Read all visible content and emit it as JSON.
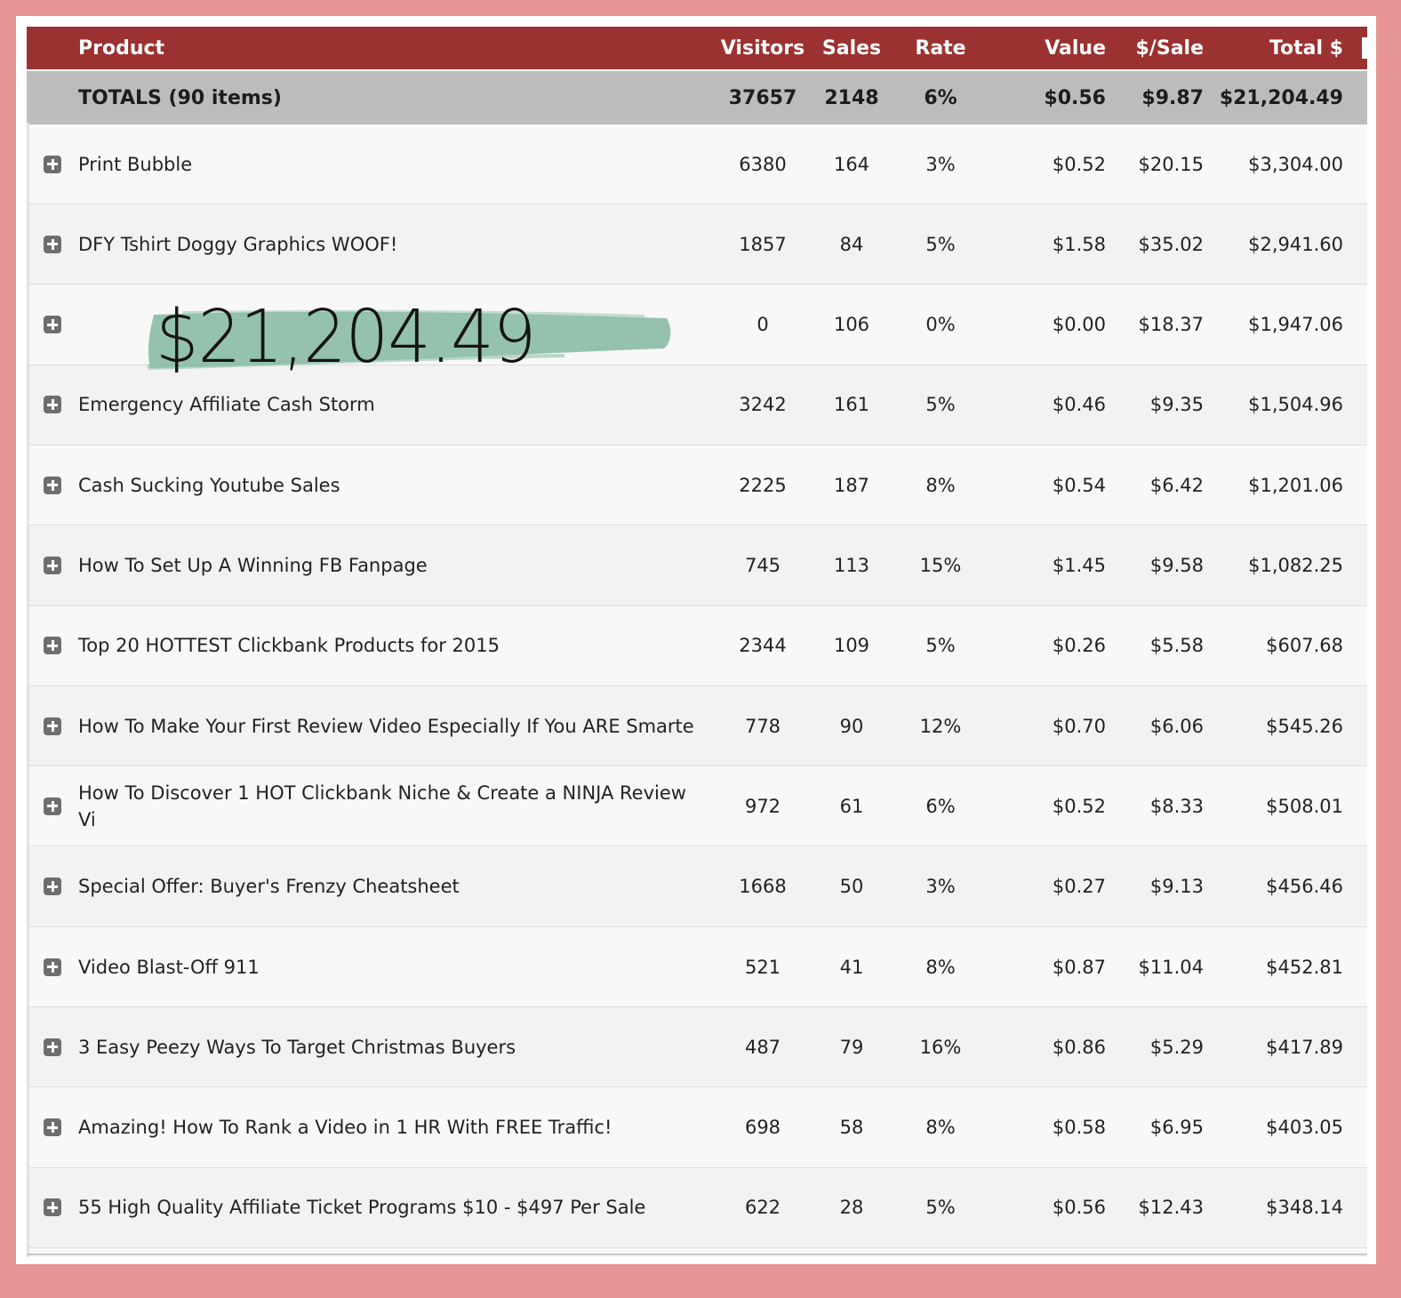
{
  "table": {
    "headers": {
      "product": "Product",
      "visitors": "Visitors",
      "sales": "Sales",
      "rate": "Rate",
      "value": "Value",
      "dollar_per_sale": "$/Sale",
      "total": "Total $"
    },
    "totals": {
      "label": "TOTALS (90 items)",
      "visitors": "37657",
      "sales": "2148",
      "rate": "6%",
      "value": "$0.56",
      "dollar_per_sale": "$9.87",
      "total": "$21,204.49"
    },
    "rows": [
      {
        "product": "Print Bubble",
        "visitors": "6380",
        "sales": "164",
        "rate": "3%",
        "value": "$0.52",
        "dollar_per_sale": "$20.15",
        "total": "$3,304.00"
      },
      {
        "product": "DFY Tshirt Doggy Graphics WOOF!",
        "visitors": "1857",
        "sales": "84",
        "rate": "5%",
        "value": "$1.58",
        "dollar_per_sale": "$35.02",
        "total": "$2,941.60"
      },
      {
        "product": "",
        "visitors": "0",
        "sales": "106",
        "rate": "0%",
        "value": "$0.00",
        "dollar_per_sale": "$18.37",
        "total": "$1,947.06"
      },
      {
        "product": "Emergency Affiliate Cash Storm",
        "visitors": "3242",
        "sales": "161",
        "rate": "5%",
        "value": "$0.46",
        "dollar_per_sale": "$9.35",
        "total": "$1,504.96"
      },
      {
        "product": "Cash Sucking Youtube Sales",
        "visitors": "2225",
        "sales": "187",
        "rate": "8%",
        "value": "$0.54",
        "dollar_per_sale": "$6.42",
        "total": "$1,201.06"
      },
      {
        "product": "How To Set Up A Winning FB Fanpage",
        "visitors": "745",
        "sales": "113",
        "rate": "15%",
        "value": "$1.45",
        "dollar_per_sale": "$9.58",
        "total": "$1,082.25"
      },
      {
        "product": "Top 20 HOTTEST Clickbank Products for 2015",
        "visitors": "2344",
        "sales": "109",
        "rate": "5%",
        "value": "$0.26",
        "dollar_per_sale": "$5.58",
        "total": "$607.68"
      },
      {
        "product": "How To Make Your First Review Video Especially If You ARE Smarte",
        "visitors": "778",
        "sales": "90",
        "rate": "12%",
        "value": "$0.70",
        "dollar_per_sale": "$6.06",
        "total": "$545.26"
      },
      {
        "product": "How To Discover 1 HOT Clickbank Niche & Create a NINJA Review Vi",
        "visitors": "972",
        "sales": "61",
        "rate": "6%",
        "value": "$0.52",
        "dollar_per_sale": "$8.33",
        "total": "$508.01"
      },
      {
        "product": "Special Offer: Buyer's Frenzy Cheatsheet",
        "visitors": "1668",
        "sales": "50",
        "rate": "3%",
        "value": "$0.27",
        "dollar_per_sale": "$9.13",
        "total": "$456.46"
      },
      {
        "product": "Video Blast-Off 911",
        "visitors": "521",
        "sales": "41",
        "rate": "8%",
        "value": "$0.87",
        "dollar_per_sale": "$11.04",
        "total": "$452.81"
      },
      {
        "product": "3 Easy Peezy Ways To Target Christmas Buyers",
        "visitors": "487",
        "sales": "79",
        "rate": "16%",
        "value": "$0.86",
        "dollar_per_sale": "$5.29",
        "total": "$417.89"
      },
      {
        "product": "Amazing! How To Rank a Video in 1 HR With FREE Traffic!",
        "visitors": "698",
        "sales": "58",
        "rate": "8%",
        "value": "$0.58",
        "dollar_per_sale": "$6.95",
        "total": "$403.05"
      },
      {
        "product": "55 High Quality Affiliate Ticket Programs $10 - $497 Per Sale",
        "visitors": "622",
        "sales": "28",
        "rate": "5%",
        "value": "$0.56",
        "dollar_per_sale": "$12.43",
        "total": "$348.14"
      }
    ]
  },
  "overlay": {
    "amount": "$21,204.49",
    "brush_color": "#8fbfa9"
  },
  "colors": {
    "header_bg": "#9b3131",
    "totals_bg": "#bcbcbc",
    "frame_border": "#e89595"
  },
  "icons": {
    "expand": "plus-square-icon"
  }
}
